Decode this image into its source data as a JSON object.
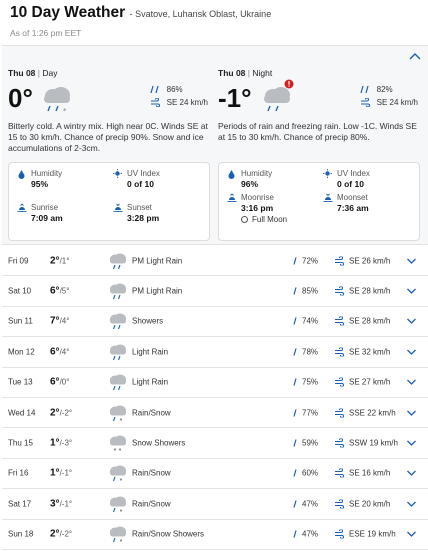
{
  "header": {
    "title": "10 Day Weather",
    "location": "- Svatove, Luhansk Oblast, Ukraine",
    "as_of": "As of 1:26 pm EET"
  },
  "colors": {
    "accent": "#1a5fb4",
    "alert": "#d32020",
    "icon_grey": "#b9bcc0"
  },
  "today": {
    "day": {
      "label": "Thu 08",
      "period": "Day",
      "temp": "0°",
      "precip": "86%",
      "wind": "SE 24 km/h",
      "description": "Bitterly cold. A wintry mix. High near 0C. Winds SE at 15 to 30 km/h. Chance of precip 90%. Snow and ice accumulations of 2-3cm.",
      "humidity_label": "Humidity",
      "humidity": "95%",
      "uv_label": "UV Index",
      "uv": "0 of 10",
      "sunrise_label": "Sunrise",
      "sunrise": "7:09 am",
      "sunset_label": "Sunset",
      "sunset": "3:28 pm"
    },
    "night": {
      "label": "Thu 08",
      "period": "Night",
      "temp": "-1°",
      "precip": "82%",
      "wind": "SE 24 km/h",
      "description": "Periods of rain and freezing rain. Low -1C. Winds SE at 15 to 30 km/h. Chance of precip 80%.",
      "humidity_label": "Humidity",
      "humidity": "96%",
      "uv_label": "UV Index",
      "uv": "0 of 10",
      "moonrise_label": "Moonrise",
      "moonrise": "3:16 pm",
      "moonset_label": "Moonset",
      "moonset": "7:36 am",
      "moon_phase": "Full Moon"
    }
  },
  "forecast": [
    {
      "day": "Fri 09",
      "high": "2°",
      "low": "/1°",
      "condition": "PM Light Rain",
      "icon": "rain-icon",
      "precip": "72%",
      "wind": "SE 26 km/h"
    },
    {
      "day": "Sat 10",
      "high": "6°",
      "low": "/5°",
      "condition": "PM Light Rain",
      "icon": "rain-icon",
      "precip": "85%",
      "wind": "SE 28 km/h"
    },
    {
      "day": "Sun 11",
      "high": "7°",
      "low": "/4°",
      "condition": "Showers",
      "icon": "rain-icon",
      "precip": "74%",
      "wind": "SE 28 km/h"
    },
    {
      "day": "Mon 12",
      "high": "6°",
      "low": "/4°",
      "condition": "Light Rain",
      "icon": "rain-icon",
      "precip": "78%",
      "wind": "SE 32 km/h"
    },
    {
      "day": "Tue 13",
      "high": "6°",
      "low": "/0°",
      "condition": "Light Rain",
      "icon": "rain-icon",
      "precip": "75%",
      "wind": "SE 27 km/h"
    },
    {
      "day": "Wed 14",
      "high": "2°",
      "low": "/-2°",
      "condition": "Rain/Snow",
      "icon": "rain-snow-icon",
      "precip": "77%",
      "wind": "SSE 22 km/h"
    },
    {
      "day": "Thu 15",
      "high": "1°",
      "low": "/-3°",
      "condition": "Snow Showers",
      "icon": "snow-icon",
      "precip": "59%",
      "wind": "SSW 19 km/h"
    },
    {
      "day": "Fri 16",
      "high": "1°",
      "low": "/-1°",
      "condition": "Rain/Snow",
      "icon": "rain-snow-icon",
      "precip": "60%",
      "wind": "SE 16 km/h"
    },
    {
      "day": "Sat 17",
      "high": "3°",
      "low": "/-1°",
      "condition": "Rain/Snow",
      "icon": "rain-snow-icon",
      "precip": "47%",
      "wind": "SE 20 km/h"
    },
    {
      "day": "Sun 18",
      "high": "2°",
      "low": "/-2°",
      "condition": "Rain/Snow Showers",
      "icon": "rain-snow-icon",
      "precip": "47%",
      "wind": "ESE 19 km/h"
    }
  ]
}
